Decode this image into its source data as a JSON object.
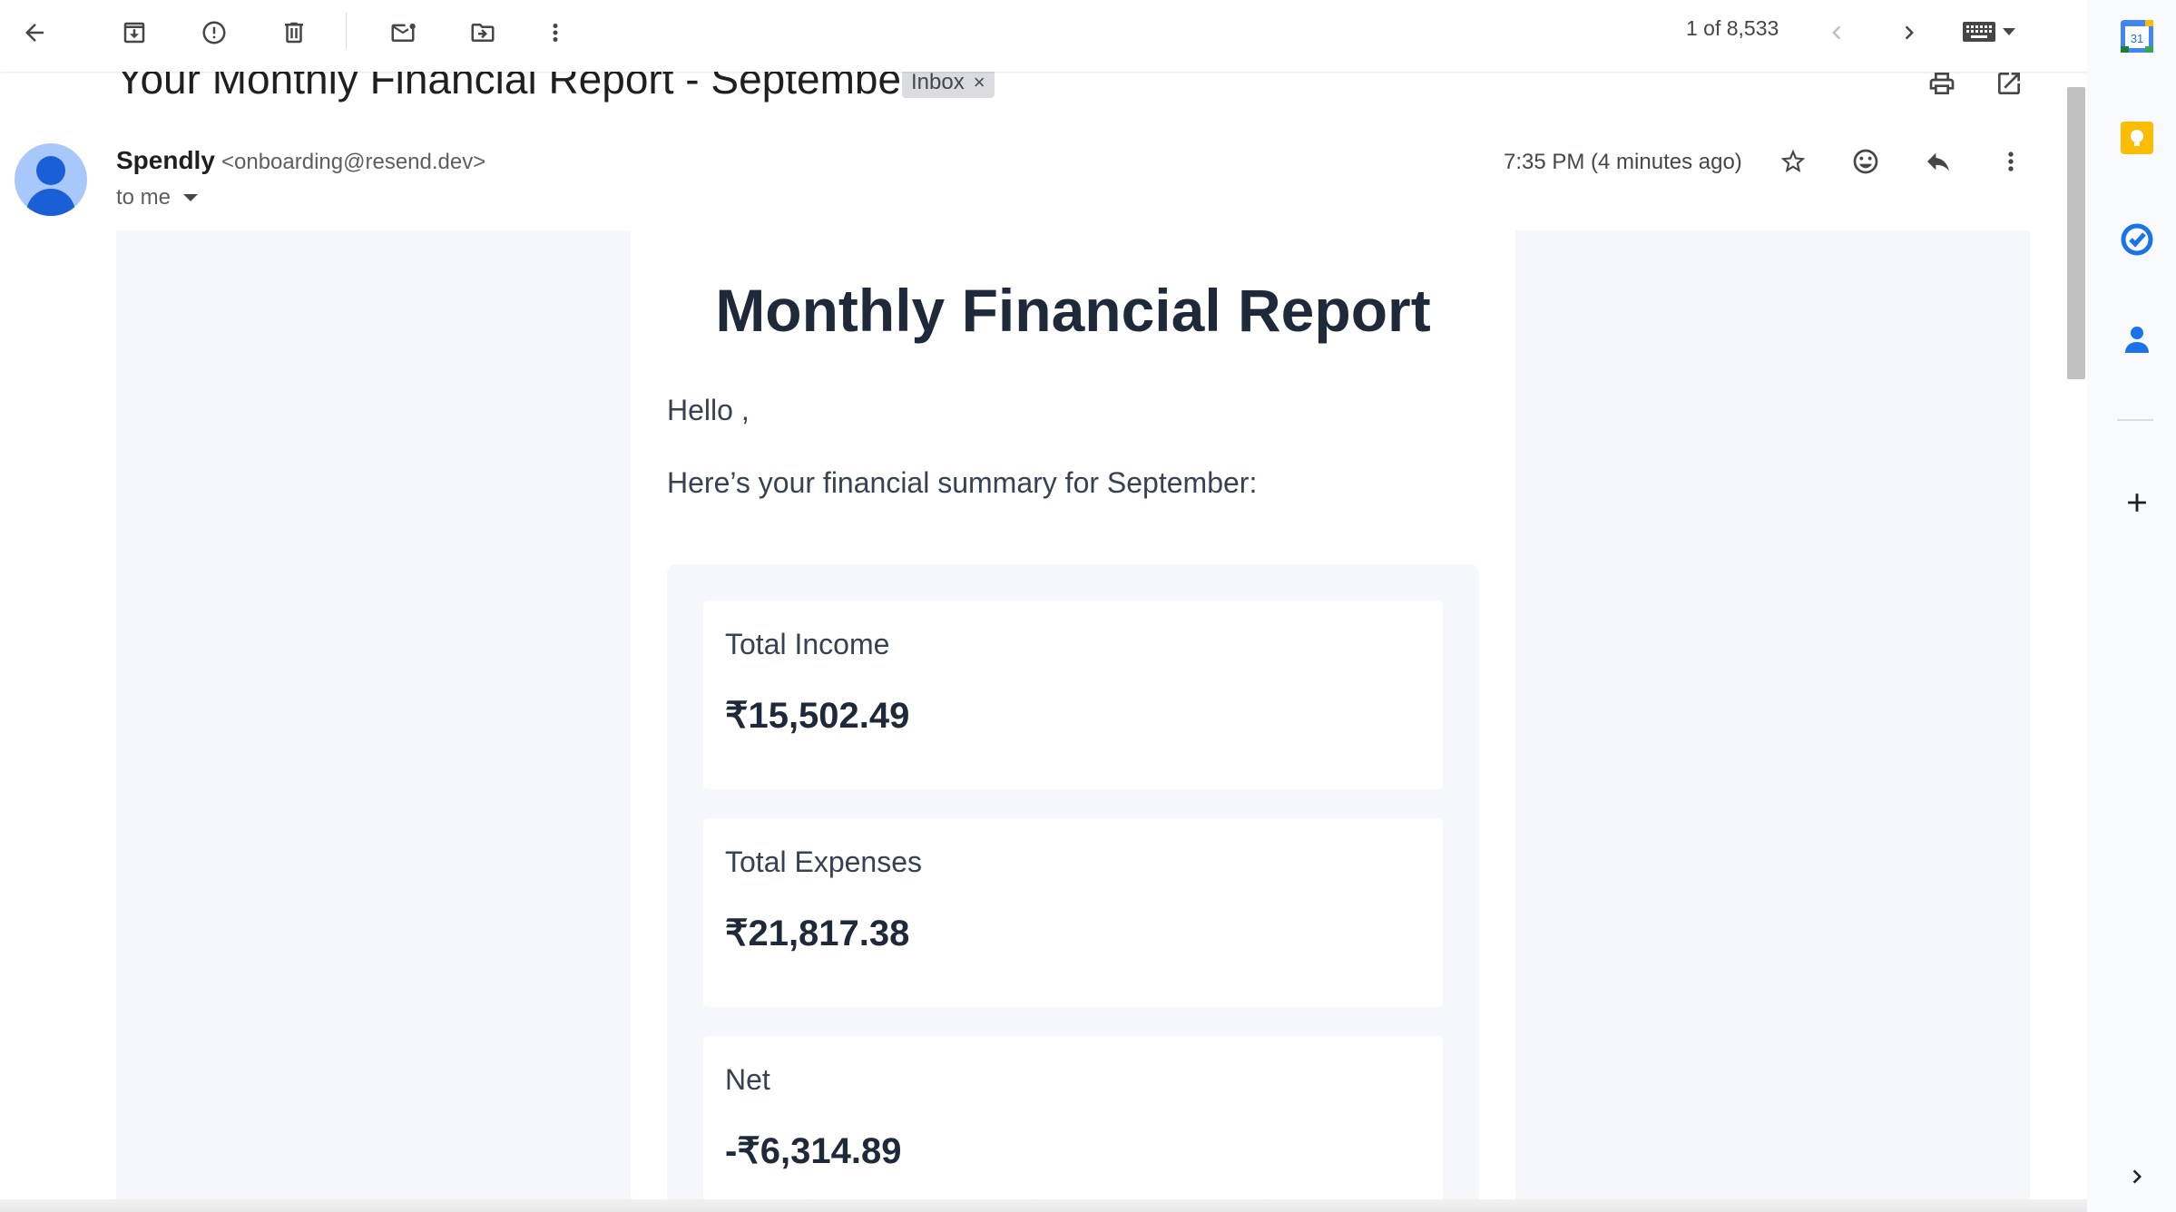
{
  "toolbar": {
    "icons": [
      "back-arrow-icon",
      "archive-icon",
      "report-spam-icon",
      "delete-icon",
      "mark-unread-icon",
      "move-to-icon",
      "more-vert-icon"
    ],
    "pager": "1 of 8,533",
    "keyboard_icon": "keyboard-icon"
  },
  "email": {
    "subject": "Your Monthly Financial Report - September",
    "label": "Inbox",
    "label_remove": "×",
    "sender_name": "Spendly",
    "sender_email": "<onboarding@resend.dev>",
    "recipient": "to me",
    "timestamp": "7:35 PM (4 minutes ago)"
  },
  "report": {
    "title": "Monthly Financial Report",
    "greeting": "Hello ,",
    "summary_intro": "Here’s your financial summary for September:",
    "stats": [
      {
        "label": "Total Income",
        "value": "₹15,502.49"
      },
      {
        "label": "Total Expenses",
        "value": "₹21,817.38"
      },
      {
        "label": "Net",
        "value": "-₹6,314.89"
      }
    ]
  },
  "side_panel": {
    "calendar_day": "31",
    "apps": [
      "calendar-icon",
      "keep-icon",
      "tasks-icon",
      "contacts-icon",
      "add-icon"
    ]
  },
  "colors": {
    "report_text": "#1e2939",
    "body_text": "#374151",
    "panel_bg": "#f6f7fb",
    "avatar_bg": "#a8c7fa",
    "avatar_fg": "#1a5fd6"
  }
}
